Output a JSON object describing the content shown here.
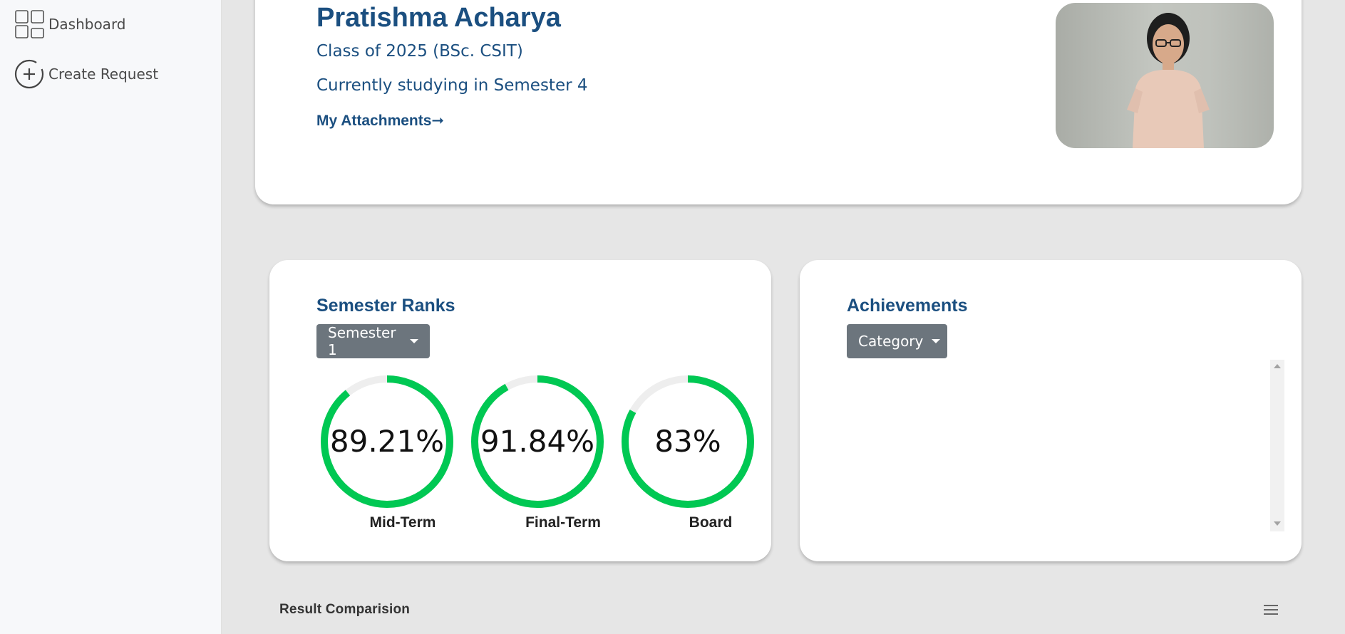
{
  "sidebar": {
    "items": [
      {
        "label": "Dashboard",
        "icon": "dashboard-icon"
      },
      {
        "label": "Create Request",
        "icon": "plus-circle-icon"
      }
    ]
  },
  "profile": {
    "name": "Pratishma Acharya",
    "class_line": "Class of 2025 (BSc. CSIT)",
    "semester_line": "Currently studying in Semester 4",
    "attachments_link": "My Attachments➞"
  },
  "ranks": {
    "title": "Semester Ranks",
    "dropdown": "Semester 1",
    "rings": [
      {
        "value_text": "89.21%",
        "percent": 89.21,
        "label": "Mid-Term"
      },
      {
        "value_text": "91.84%",
        "percent": 91.84,
        "label": "Final-Term"
      },
      {
        "value_text": "83%",
        "percent": 83,
        "label": "Board"
      }
    ],
    "ring_color": "#00c853",
    "ring_track_color": "#eeeeee"
  },
  "achievements": {
    "title": "Achievements",
    "dropdown": "Category"
  },
  "result": {
    "title": "Result Comparision"
  },
  "colors": {
    "primary_text": "#1b4f80",
    "dropdown_bg": "#6c757d",
    "page_bg": "#e6e6e6"
  }
}
